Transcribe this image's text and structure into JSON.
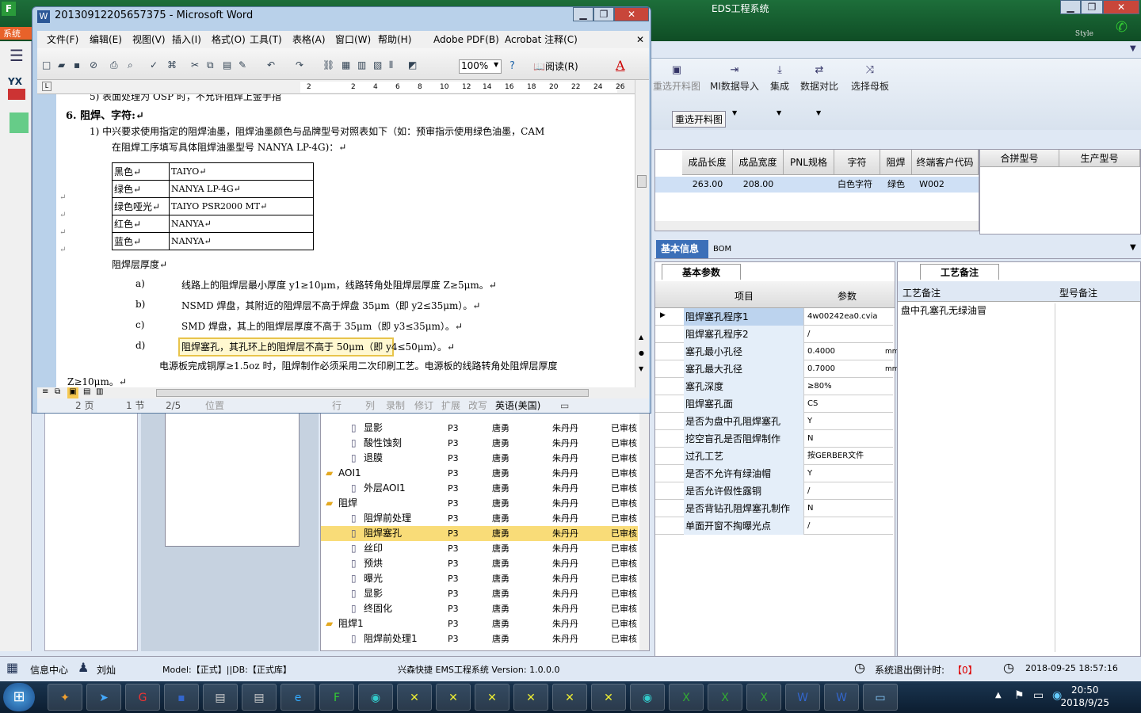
{
  "eds": {
    "title": "EDS工程系统",
    "style_label": "Style",
    "menu_label": "系统",
    "toolbar": [
      "重选开料图",
      "MI数据导入",
      "集成",
      "数据对比",
      "选择母板"
    ],
    "reselect_button": "重选开料图",
    "yx_label": "YX",
    "grid_cols": [
      "成品长度",
      "成品宽度",
      "PNL规格",
      "字符",
      "阻焊",
      "终端客户代码"
    ],
    "grid_row": [
      "263.00",
      "208.00",
      "",
      "白色字符",
      "绿色",
      "W002"
    ],
    "grid2_cols": [
      "合拼型号",
      "生产型号"
    ],
    "tab_basic": "基本信息",
    "tab_bom": "BOM",
    "tab_params": "基本参数",
    "tab_notes": "工艺备注",
    "param_headers": [
      "项目",
      "参数"
    ],
    "params": [
      {
        "k": "阻焊塞孔程序1",
        "v": "4w00242ea0.cvia"
      },
      {
        "k": "阻焊塞孔程序2",
        "v": "/"
      },
      {
        "k": "塞孔最小孔径",
        "v": "0.4000"
      },
      {
        "k": "塞孔最大孔径",
        "v": "0.7000"
      },
      {
        "k": "塞孔深度",
        "v": "≥80%"
      },
      {
        "k": "阻焊塞孔面",
        "v": "CS"
      },
      {
        "k": "是否为盘中孔阻焊塞孔",
        "v": "Y"
      },
      {
        "k": "挖空盲孔是否阻焊制作",
        "v": "N"
      },
      {
        "k": "过孔工艺",
        "v": "按GERBER文件"
      },
      {
        "k": "是否不允许有绿油帽",
        "v": "Y"
      },
      {
        "k": "是否允许假性露铜",
        "v": "/"
      },
      {
        "k": "是否背钻孔阻焊塞孔制作",
        "v": "N"
      },
      {
        "k": "单面开窗不掏曝光点",
        "v": "/"
      }
    ],
    "param_unit": "mm",
    "notes_headers": [
      "工艺备注",
      "型号备注"
    ],
    "notes_text": "盘中孔塞孔无绿油冒",
    "tree": [
      {
        "name": "显影",
        "lvl": 2,
        "c": [
          "P3",
          "唐勇",
          "朱丹丹",
          "已审核"
        ]
      },
      {
        "name": "酸性蚀刻",
        "lvl": 2,
        "c": [
          "P3",
          "唐勇",
          "朱丹丹",
          "已审核"
        ]
      },
      {
        "name": "退膜",
        "lvl": 2,
        "c": [
          "P3",
          "唐勇",
          "朱丹丹",
          "已审核"
        ]
      },
      {
        "name": "AOI1",
        "lvl": 1,
        "c": [
          "P3",
          "唐勇",
          "朱丹丹",
          "已审核"
        ]
      },
      {
        "name": "外层AOI1",
        "lvl": 2,
        "c": [
          "P3",
          "唐勇",
          "朱丹丹",
          "已审核"
        ]
      },
      {
        "name": "阻焊",
        "lvl": 1,
        "c": [
          "P3",
          "唐勇",
          "朱丹丹",
          "已审核"
        ]
      },
      {
        "name": "阻焊前处理",
        "lvl": 2,
        "c": [
          "P3",
          "唐勇",
          "朱丹丹",
          "已审核"
        ]
      },
      {
        "name": "阻焊塞孔",
        "lvl": 2,
        "c": [
          "P3",
          "唐勇",
          "朱丹丹",
          "已审核"
        ]
      },
      {
        "name": "丝印",
        "lvl": 2,
        "c": [
          "P3",
          "唐勇",
          "朱丹丹",
          "已审核"
        ]
      },
      {
        "name": "预烘",
        "lvl": 2,
        "c": [
          "P3",
          "唐勇",
          "朱丹丹",
          "已审核"
        ]
      },
      {
        "name": "曝光",
        "lvl": 2,
        "c": [
          "P3",
          "唐勇",
          "朱丹丹",
          "已审核"
        ]
      },
      {
        "name": "显影",
        "lvl": 2,
        "c": [
          "P3",
          "唐勇",
          "朱丹丹",
          "已审核"
        ]
      },
      {
        "name": "终固化",
        "lvl": 2,
        "c": [
          "P3",
          "唐勇",
          "朱丹丹",
          "已审核"
        ]
      },
      {
        "name": "阻焊1",
        "lvl": 1,
        "c": [
          "P3",
          "唐勇",
          "朱丹丹",
          "已审核"
        ]
      },
      {
        "name": "阻焊前处理1",
        "lvl": 2,
        "c": [
          "P3",
          "唐勇",
          "朱丹丹",
          "已审核"
        ]
      }
    ],
    "status": {
      "info": "信息中心",
      "user": "刘灿",
      "model": "Model:【正式】||DB:【正式库】",
      "app": "兴森快捷 EMS工程系统 Version: 1.0.0.0",
      "countdown_label": "系统退出倒计时:",
      "countdown": "【0】",
      "datetime": "2018-09-25 18:57:16"
    }
  },
  "word": {
    "title": "20130912205657375 - Microsoft Word",
    "menu": [
      "文件(F)",
      "编辑(E)",
      "视图(V)",
      "插入(I)",
      "格式(O)",
      "工具(T)",
      "表格(A)",
      "窗口(W)",
      "帮助(H)",
      "Adobe PDF(B)",
      "Acrobat 注释(C)"
    ],
    "zoom": "100%",
    "read_button": "阅读(R)",
    "ruler": [
      "2",
      "2",
      "4",
      "6",
      "8",
      "10",
      "12",
      "14",
      "16",
      "18",
      "20",
      "22",
      "24",
      "26"
    ],
    "doc": {
      "top_line": "5) 表面处理为 OSP 时，不允许阻焊上金手指",
      "heading": "6.   阻焊、字符:↵",
      "p1": "1) 中兴要求使用指定的阻焊油墨，阻焊油墨颜色与品牌型号对照表如下（如：预审指示使用绿色油墨，CAM",
      "p1b": "在阻焊工序填写具体阻焊油墨型号 NANYA  LP-4G)：↵",
      "table": [
        [
          "黑色↵",
          "TAIYO↵"
        ],
        [
          "绿色↵",
          "NANYA  LP-4G↵"
        ],
        [
          "绿色哑光↵",
          "TAIYO   PSR2000 MT↵"
        ],
        [
          "红色↵",
          "NANYA↵"
        ],
        [
          "蓝色↵",
          "NANYA↵"
        ]
      ],
      "sub": "阻焊层厚度↵",
      "items": [
        {
          "m": "a)",
          "t": "线路上的阻焊层最小厚度 y1≥10μm，线路转角处阻焊层厚度 Z≥5μm。↵"
        },
        {
          "m": "b)",
          "t": "NSMD 焊盘，其附近的阻焊层不高于焊盘 35μm（即 y2≤35μm）。↵"
        },
        {
          "m": "c)",
          "t": "SMD 焊盘，其上的阻焊层厚度不高于 35μm（即 y3≤35μm）。↵"
        },
        {
          "m": "d)",
          "t": "阻焊塞孔，其孔环上的阻焊层不高于 50μm（即 y4≤50μm）。↵"
        }
      ],
      "p2": "电源板完成铜厚≥1.5oz 时，阻焊制作必须采用二次印刷工艺。电源板的线路转角处阻焊层厚度",
      "p2b": "Z≥10μm。↵"
    },
    "status": {
      "page": "2 页",
      "section": "1 节",
      "of": "2/5",
      "pos": "位置",
      "line": "行",
      "col": "列",
      "rec": "录制",
      "rev": "修订",
      "ext": "扩展",
      "ovr": "改写",
      "lang": "英语(美国)"
    }
  },
  "taskbar": {
    "time": "20:50",
    "date": "2018/9/25"
  }
}
